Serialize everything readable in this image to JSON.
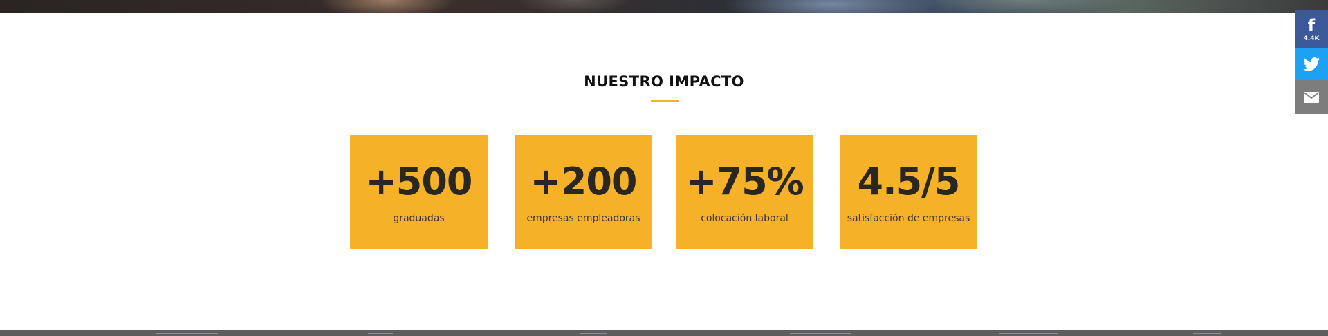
{
  "impact": {
    "title": "NUESTRO IMPACTO",
    "accent_color": "#f5b127",
    "stats": [
      {
        "value": "+500",
        "label": "graduadas"
      },
      {
        "value": "+200",
        "label": "empresas empleadoras"
      },
      {
        "value": "+75%",
        "label": "colocación laboral"
      },
      {
        "value": "4.5/5",
        "label": "satisfacción de empresas"
      }
    ]
  },
  "share_bar": {
    "facebook": {
      "icon": "facebook-icon",
      "count": "4.4K",
      "color": "#3b5998"
    },
    "twitter": {
      "icon": "twitter-icon",
      "color": "#1da1f2"
    },
    "email": {
      "icon": "email-icon",
      "color": "#7d7d7d"
    }
  }
}
